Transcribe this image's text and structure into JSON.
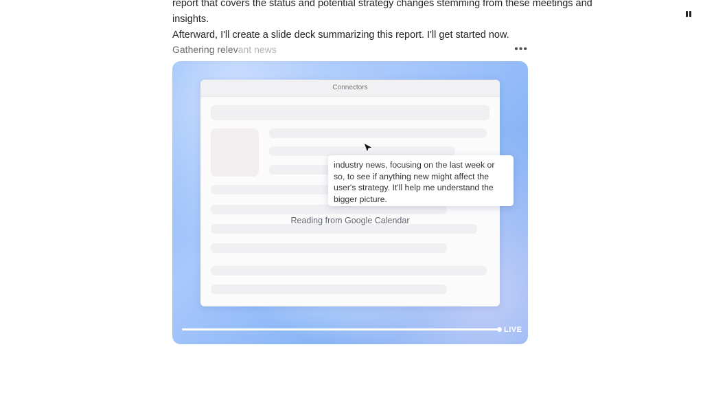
{
  "message": {
    "line1": "report that covers the status and potential strategy changes stemming from these meetings and insights.",
    "line2": "Afterward, I'll create a slide deck summarizing this report. I'll get started now."
  },
  "controls": {
    "pause_icon": "pause-icon",
    "more_icon": "more-horizontal-icon"
  },
  "task": {
    "title_main": "Gathering relev",
    "title_faded": "ant news"
  },
  "replay": {
    "panel_title": "Connectors",
    "tooltip_text": "industry news, focusing on the last week or so, to see if anything new might affect the user's strategy. It'll help me understand the bigger picture.",
    "status_text": "Reading from Google Calendar",
    "live_label": "LIVE",
    "progress_fraction": 1.0
  },
  "colors": {
    "accent_blue": "#7fb0f5",
    "text_dark": "#222222",
    "muted": "#6b6b6b"
  }
}
